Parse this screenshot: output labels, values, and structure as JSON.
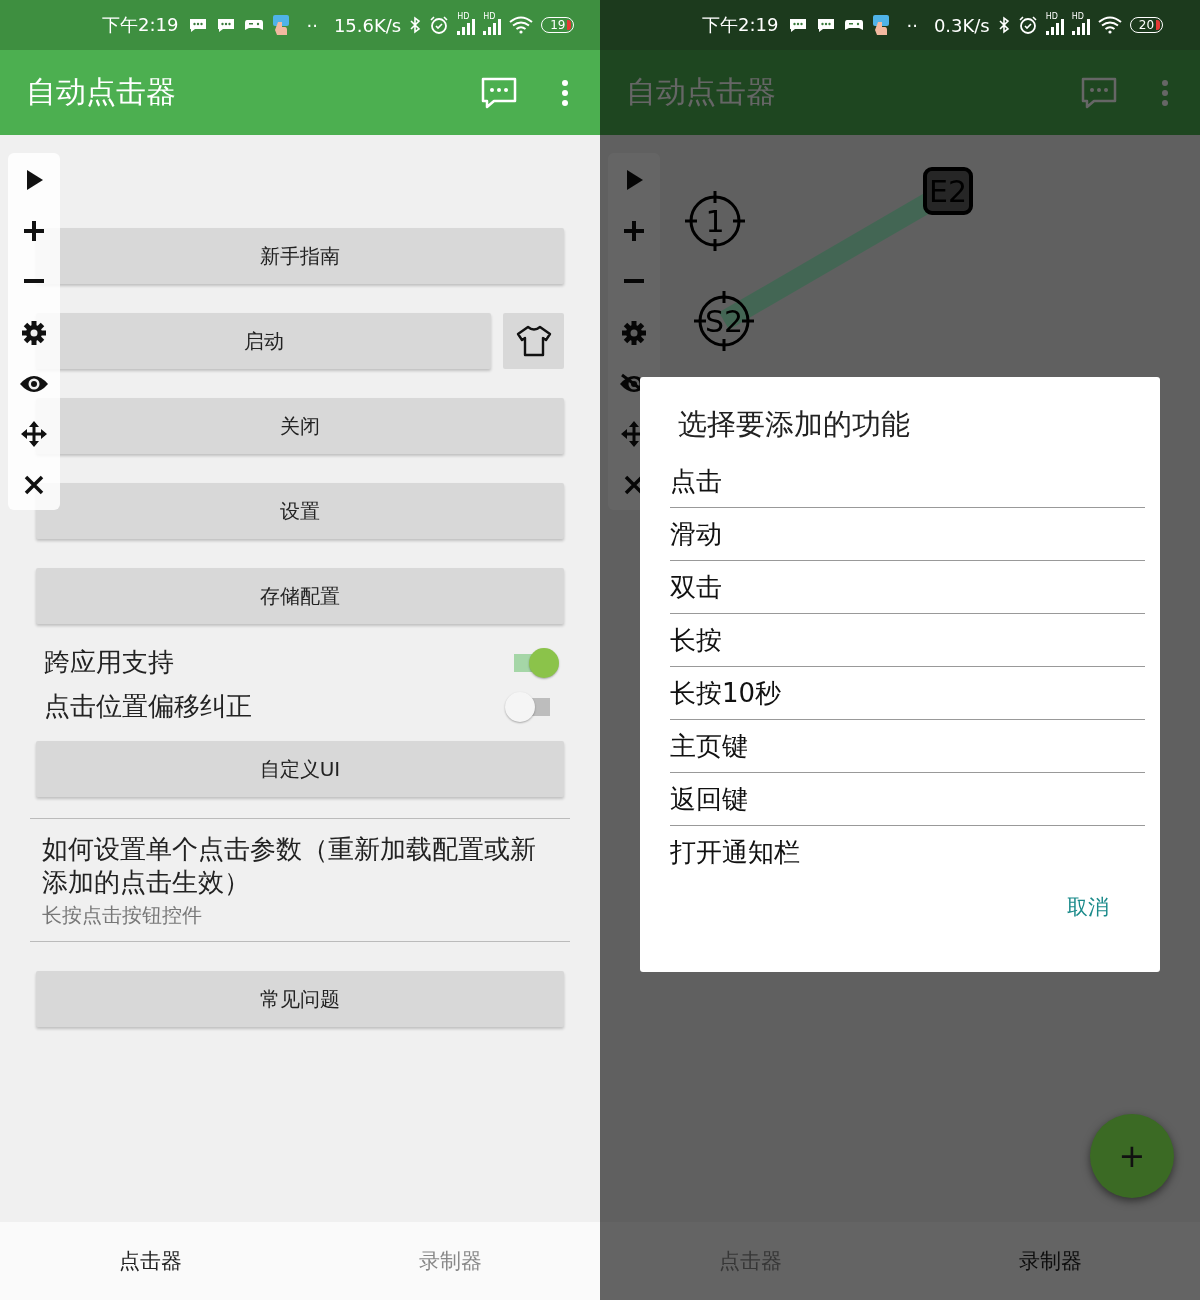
{
  "screens": [
    {
      "status_bar": {
        "time": "下午2:19",
        "dots": "··",
        "speed": "15.6K/s",
        "signal_labels": [
          "HD",
          "HD"
        ],
        "battery": "19"
      },
      "app_bar": {
        "title": "自动点击器"
      },
      "content": [
        {
          "kind": "button",
          "label": "新手指南"
        },
        {
          "kind": "button_with_icon",
          "label": "启动"
        },
        {
          "kind": "button",
          "label": "关闭"
        },
        {
          "kind": "button",
          "label": "设置"
        },
        {
          "kind": "button",
          "label": "存储配置"
        },
        {
          "kind": "switch",
          "label": "跨应用支持",
          "on": true
        },
        {
          "kind": "switch",
          "label": "点击位置偏移纠正",
          "on": false
        },
        {
          "kind": "button",
          "label": "自定义UI"
        },
        {
          "kind": "info",
          "title": "如何设置单个点击参数（重新加载配置或新添加的点击生效）",
          "subtitle": "长按点击按钮控件"
        },
        {
          "kind": "button",
          "label": "常见问题"
        }
      ],
      "bottom_nav": [
        {
          "label": "点击器",
          "selected": true
        },
        {
          "label": "录制器",
          "selected": false
        }
      ]
    },
    {
      "status_bar": {
        "time": "下午2:19",
        "dots": "··",
        "speed": "0.3K/s",
        "signal_labels": [
          "HD",
          "HD"
        ],
        "battery": "20"
      },
      "app_bar": {
        "title": "自动点击器"
      },
      "markers": [
        {
          "kind": "target",
          "label": "1"
        },
        {
          "kind": "target",
          "label": "S2"
        },
        {
          "kind": "end",
          "label": "E2"
        }
      ],
      "dialog": {
        "title": "选择要添加的功能",
        "options": [
          "点击",
          "滑动",
          "双击",
          "长按",
          "长按10秒",
          "主页键",
          "返回键",
          "打开通知栏"
        ],
        "cancel": "取消"
      },
      "fab": {
        "label": "+"
      },
      "bottom_nav": [
        {
          "label": "点击器",
          "selected": false
        },
        {
          "label": "录制器",
          "selected": true
        }
      ]
    }
  ]
}
